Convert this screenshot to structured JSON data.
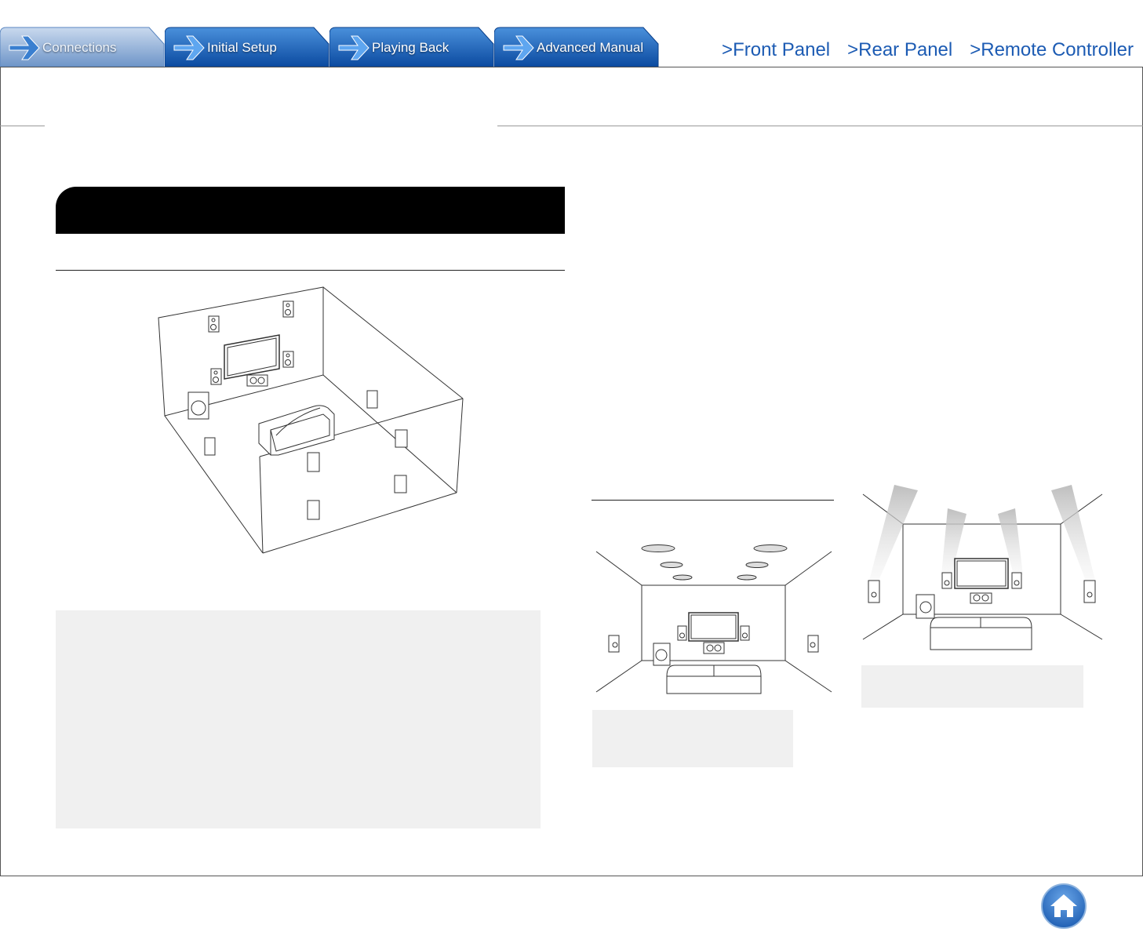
{
  "nav_tabs": [
    {
      "label": "Connections",
      "active": false
    },
    {
      "label": "Initial Setup",
      "active": true
    },
    {
      "label": "Playing Back",
      "active": true
    },
    {
      "label": "Advanced Manual",
      "active": true
    }
  ],
  "top_links": [
    {
      "label": ">Front Panel"
    },
    {
      "label": ">Rear Panel"
    },
    {
      "label": ">Remote Controller"
    }
  ],
  "colors": {
    "tab_active_top": "#3f86d2",
    "tab_active_bottom": "#0d4ea6",
    "tab_inactive_top": "#b9cde8",
    "tab_inactive_bottom": "#6f96c9",
    "link": "#1c5bb3",
    "note_box": "#f0f0f0",
    "home_button": "#2f6fc0"
  },
  "icons": {
    "tab_arrow": "arrow-right-icon",
    "home": "home-icon"
  }
}
